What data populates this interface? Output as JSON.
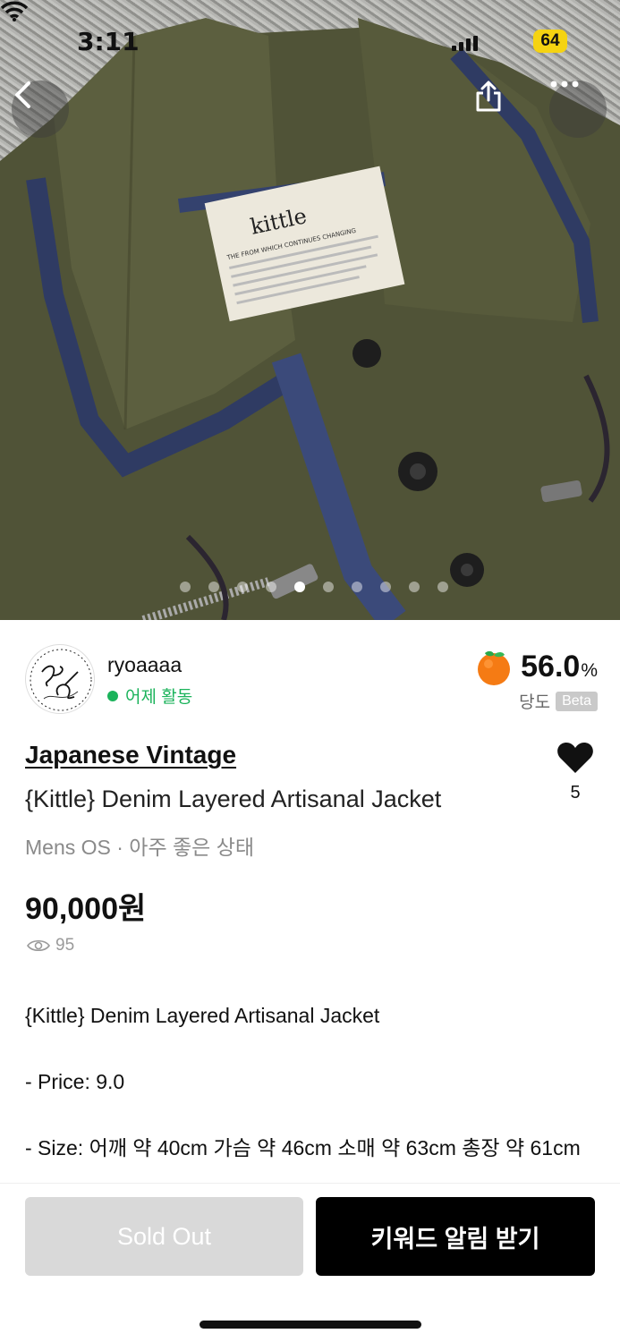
{
  "status_bar": {
    "time": "3:11",
    "battery": "64"
  },
  "hero": {
    "photo": "Olive herringbone jacket with denim-trimmed collar and Kittle label",
    "label_text": "kittle",
    "label_sub": "THE FROM WHICH CONTINUES CHANGING",
    "image_count": 10,
    "active_index": 4
  },
  "nav": {
    "back_icon": "chevron-left-icon",
    "share_icon": "share-icon",
    "more_icon": "more-horizontal-icon"
  },
  "seller": {
    "name": "ryoaaaa",
    "status": "어제 활동",
    "status_color": "#1bb35b",
    "sweetness_value": "56.0",
    "sweetness_unit": "%",
    "sweetness_label": "당도",
    "beta_badge": "Beta"
  },
  "product": {
    "brand": "Japanese Vintage",
    "title": "{Kittle} Denim Layered Artisanal Jacket",
    "meta": "Mens OS · 아주 좋은 상태",
    "price": "90,000원",
    "likes": "5",
    "views": "95"
  },
  "description": [
    "{Kittle} Denim Layered Artisanal Jacket",
    " - Price: 9.0",
    " - Size: 어깨 약 40cm 가슴 약 46cm 소매 약 63cm 총장 약 61cm"
  ],
  "actions": {
    "sold_out": "Sold Out",
    "keyword_alert": "키워드 알림 받기"
  },
  "colors": {
    "accent_green": "#1bb35b",
    "primary_button": "#000000",
    "disabled_button": "#d9d9d9",
    "battery": "#f5d312"
  }
}
